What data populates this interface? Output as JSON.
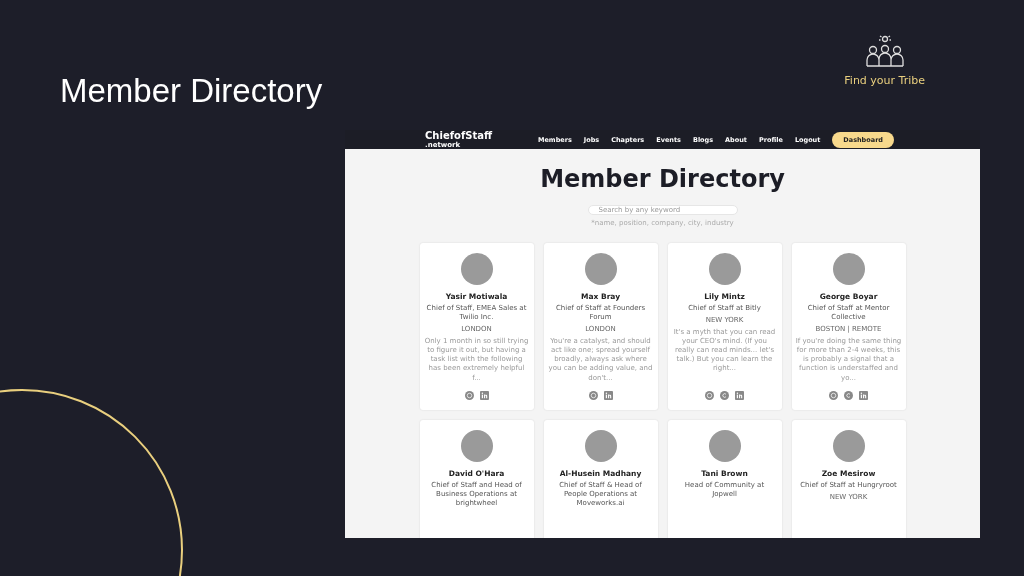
{
  "slide": {
    "title": "Member Directory",
    "logo_caption": "Find your Tribe"
  },
  "site": {
    "logo": "ChiefofStaff",
    "logo_sub": ".network",
    "nav": [
      {
        "label": "Members"
      },
      {
        "label": "Jobs"
      },
      {
        "label": "Chapters"
      },
      {
        "label": "Events"
      },
      {
        "label": "Blogs"
      },
      {
        "label": "About"
      },
      {
        "label": "Profile"
      },
      {
        "label": "Logout"
      }
    ],
    "dashboard_button": "Dashboard",
    "heading": "Member Directory",
    "search": {
      "placeholder": "Search by any keyword"
    },
    "search_hint": "*name, position, company, city, industry",
    "members": [
      {
        "name": "Yasir Motiwala",
        "role": "Chief of Staff, EMEA Sales at Twilio Inc.",
        "location": "LONDON",
        "quote": "Only 1 month in so still trying to figure it out, but having a task list with the following has been extremely helpful f...",
        "links": [
          {
            "kind": "web"
          },
          {
            "kind": "linkedin"
          }
        ]
      },
      {
        "name": "Max Bray",
        "role": "Chief of Staff at Founders Forum",
        "location": "LONDON",
        "quote": "You're a catalyst, and should act like one; spread yourself broadly, always ask where you can be adding value, and don't...",
        "links": [
          {
            "kind": "web"
          },
          {
            "kind": "linkedin"
          }
        ]
      },
      {
        "name": "Lily Mintz",
        "role": "Chief of Staff at Bitly",
        "location": "NEW YORK",
        "quote": "It's a myth that you can read your CEO's mind. (If you really can read minds... let's talk.) But you can learn the right...",
        "links": [
          {
            "kind": "web"
          },
          {
            "kind": "company"
          },
          {
            "kind": "linkedin"
          }
        ]
      },
      {
        "name": "George Boyar",
        "role": "Chief of Staff at Mentor Collective",
        "location": "BOSTON | REMOTE",
        "quote": "If you're doing the same thing for more than 2-4 weeks, this is probably a signal that a function is understaffed and yo...",
        "links": [
          {
            "kind": "web"
          },
          {
            "kind": "company"
          },
          {
            "kind": "linkedin"
          }
        ]
      },
      {
        "name": "David O'Hara",
        "role": "Chief of Staff and Head of Business Operations at brightwheel"
      },
      {
        "name": "Al-Husein Madhany",
        "role": "Chief of Staff & Head of People Operations at Moveworks.ai"
      },
      {
        "name": "Tani Brown",
        "role": "Head of Community at Jopwell"
      },
      {
        "name": "Zoe Mesirow",
        "role": "Chief of Staff at Hungryroot",
        "location": "NEW YORK"
      }
    ]
  }
}
